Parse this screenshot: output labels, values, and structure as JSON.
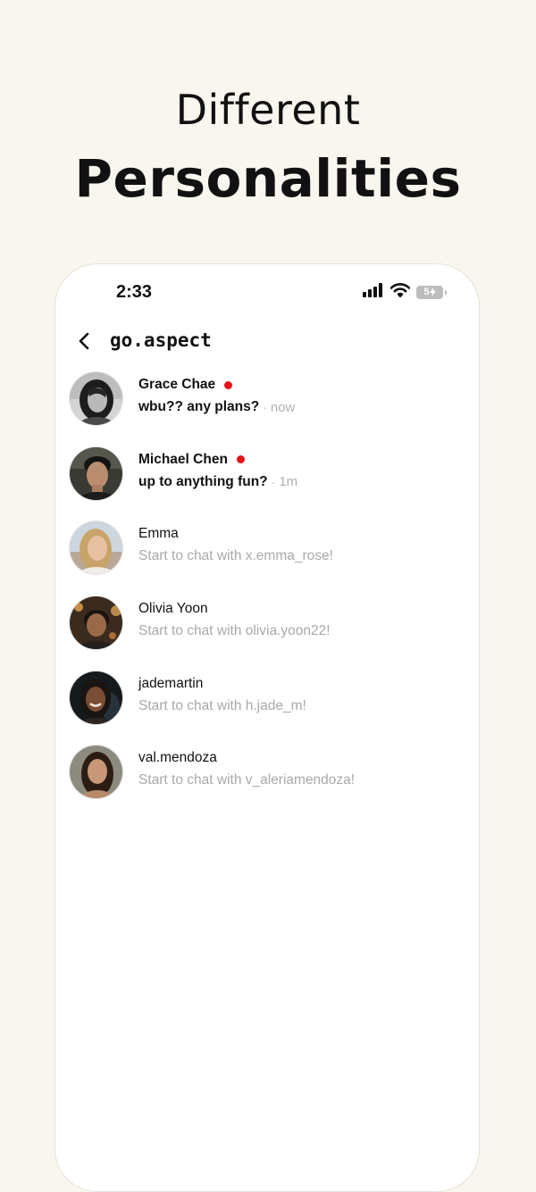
{
  "headline": {
    "line1": "Different",
    "line2": "Personalities"
  },
  "status_bar": {
    "time": "2:33",
    "battery": "5"
  },
  "header": {
    "title": "go.aspect"
  },
  "chats": [
    {
      "name": "Grace Chae",
      "message": "wbu?? any plans?",
      "separator": "·",
      "time": "now",
      "unread": true,
      "avatar": "grace-chae-avatar"
    },
    {
      "name": "Michael Chen",
      "message": "up to anything fun?",
      "separator": "·",
      "time": "1m",
      "unread": true,
      "avatar": "michael-chen-avatar"
    },
    {
      "name": "Emma",
      "message": "Start to chat with x.emma_rose!",
      "unread": false,
      "avatar": "emma-avatar"
    },
    {
      "name": "Olivia Yoon",
      "message": "Start to chat with olivia.yoon22!",
      "unread": false,
      "avatar": "olivia-yoon-avatar"
    },
    {
      "name": "jademartin",
      "message": "Start to chat with h.jade_m!",
      "unread": false,
      "avatar": "jademartin-avatar"
    },
    {
      "name": "val.mendoza",
      "message": "Start to chat with v_aleriamendoza!",
      "unread": false,
      "avatar": "val-mendoza-avatar"
    }
  ],
  "colors": {
    "page_background": "#f8f6ef",
    "unread_dot": "#e8141a",
    "muted_text": "#a9a9a9"
  }
}
